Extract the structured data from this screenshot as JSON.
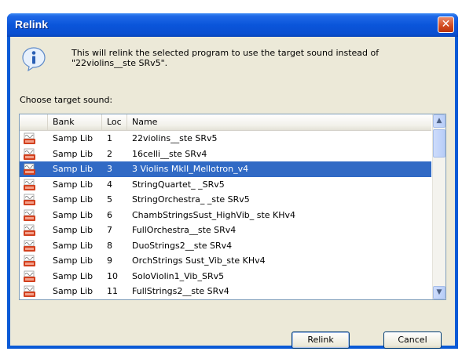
{
  "window": {
    "title": "Relink",
    "close_glyph": "✕"
  },
  "message": {
    "line1": "This will relink the selected program to use the target sound instead of",
    "line2": "\"22violins__ste SRv5\"."
  },
  "choose_label": "Choose target sound:",
  "columns": {
    "bank": "Bank",
    "loc": "Loc",
    "name": "Name"
  },
  "rows": [
    {
      "bank": "Samp Lib",
      "loc": "1",
      "name": "22violins__ste SRv5",
      "selected": false
    },
    {
      "bank": "Samp Lib",
      "loc": "2",
      "name": "16celli__ste SRv4",
      "selected": false
    },
    {
      "bank": "Samp Lib",
      "loc": "3",
      "name": "3 Violins MkII_Mellotron_v4",
      "selected": true
    },
    {
      "bank": "Samp Lib",
      "loc": "4",
      "name": "StringQuartet_ _SRv5",
      "selected": false
    },
    {
      "bank": "Samp Lib",
      "loc": "5",
      "name": "StringOrchestra_ _ste SRv5",
      "selected": false
    },
    {
      "bank": "Samp Lib",
      "loc": "6",
      "name": "ChambStringsSust_HighVib_ ste KHv4",
      "selected": false
    },
    {
      "bank": "Samp Lib",
      "loc": "7",
      "name": "FullOrchestra__ste SRv4",
      "selected": false
    },
    {
      "bank": "Samp Lib",
      "loc": "8",
      "name": "DuoStrings2__ste SRv4",
      "selected": false
    },
    {
      "bank": "Samp Lib",
      "loc": "9",
      "name": "OrchStrings Sust_Vib_ste KHv4",
      "selected": false
    },
    {
      "bank": "Samp Lib",
      "loc": "10",
      "name": "SoloViolin1_Vib_SRv5",
      "selected": false
    },
    {
      "bank": "Samp Lib",
      "loc": "11",
      "name": "FullStrings2__ste SRv4",
      "selected": false
    }
  ],
  "buttons": {
    "relink": "Relink",
    "cancel": "Cancel"
  },
  "icons": {
    "info": "info-icon",
    "sample": "sample-icon"
  },
  "colors": {
    "selection": "#316ac5",
    "titlebar": "#0a55da",
    "client": "#ece9d8"
  }
}
